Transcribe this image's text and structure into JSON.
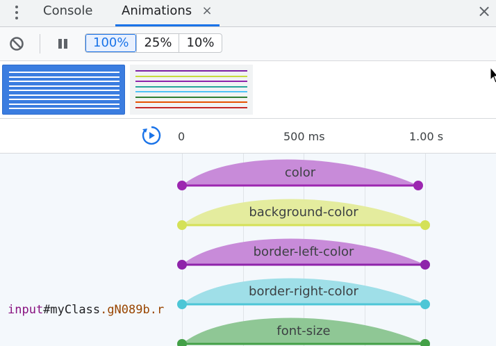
{
  "tabbar": {
    "tabs": [
      {
        "label": "Console"
      },
      {
        "label": "Animations",
        "close": "×"
      }
    ],
    "close_panel": "×"
  },
  "toolbar": {
    "speeds": [
      "100%",
      "25%",
      "10%"
    ],
    "selected_speed": "100%"
  },
  "groups": {
    "selected_colors": [
      "#ffffff"
    ],
    "other_colors": [
      "#7b1fa2",
      "#c6da3b",
      "#8e24aa",
      "#26a69a",
      "#4fc3f7",
      "#2e7d32",
      "#e65100",
      "#c62828"
    ]
  },
  "timeline": {
    "ticks": [
      "0",
      "500 ms",
      "1.00 s"
    ]
  },
  "node": {
    "tag": "input",
    "id": "#myClass",
    "classes": ".gN089b.r"
  },
  "animations": [
    {
      "name": "color",
      "color": "#9c27b0",
      "fill": "#c88bd9"
    },
    {
      "name": "background-color",
      "color": "#d4e157",
      "fill": "#e4ec9e"
    },
    {
      "name": "border-left-color",
      "color": "#8e24aa",
      "fill": "#c88bd9"
    },
    {
      "name": "border-right-color",
      "color": "#4dc6d6",
      "fill": "#9fdfe8"
    },
    {
      "name": "font-size",
      "color": "#43a047",
      "fill": "#8fc795"
    }
  ]
}
